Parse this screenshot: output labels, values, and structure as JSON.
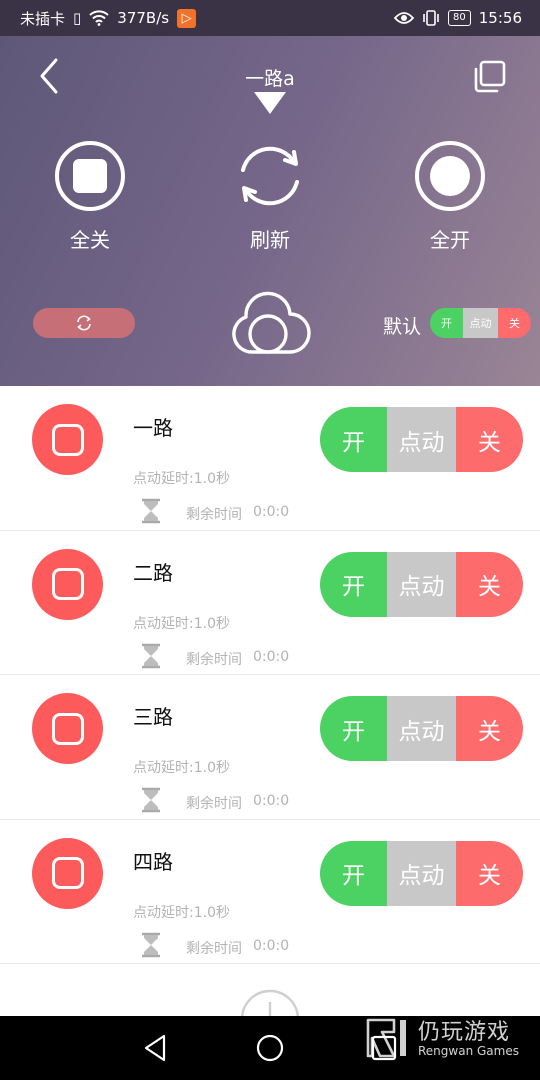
{
  "status_bar": {
    "carrier": "未插卡",
    "net_speed": "377B/s",
    "battery": "80",
    "time": "15:56"
  },
  "header": {
    "title": "一路a",
    "actions": [
      {
        "label": "全关"
      },
      {
        "label": "刷新"
      },
      {
        "label": "全开"
      }
    ],
    "default_label": "默认",
    "mini_toggle": {
      "on": "开",
      "pulse": "点动",
      "off": "关"
    }
  },
  "channels": [
    {
      "name": "一路",
      "delay": "点动延时:1.0秒",
      "remain_label": "剩余时间",
      "remain_value": "0:0:0",
      "on": "开",
      "pulse": "点动",
      "off": "关"
    },
    {
      "name": "二路",
      "delay": "点动延时:1.0秒",
      "remain_label": "剩余时间",
      "remain_value": "0:0:0",
      "on": "开",
      "pulse": "点动",
      "off": "关"
    },
    {
      "name": "三路",
      "delay": "点动延时:1.0秒",
      "remain_label": "剩余时间",
      "remain_value": "0:0:0",
      "on": "开",
      "pulse": "点动",
      "off": "关"
    },
    {
      "name": "四路",
      "delay": "点动延时:1.0秒",
      "remain_label": "剩余时间",
      "remain_value": "0:0:0",
      "on": "开",
      "pulse": "点动",
      "off": "关"
    }
  ],
  "watermark": {
    "cn": "仍玩游戏",
    "en": "Rengwan Games"
  },
  "colors": {
    "on": "#4cd262",
    "pulse": "#c8c8c8",
    "off": "#fd6b6d",
    "channel_icon": "#fd5a5c"
  },
  "icons": [
    "back-icon",
    "copy-icon",
    "dropdown-caret-icon",
    "stop-icon",
    "refresh-icon",
    "record-icon",
    "cloud-icon",
    "hourglass-icon",
    "add-icon"
  ]
}
